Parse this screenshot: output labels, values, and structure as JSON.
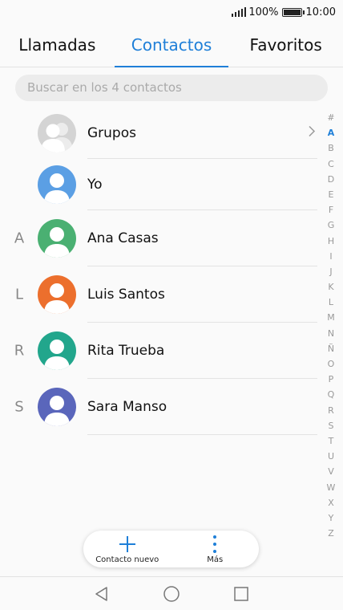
{
  "status_bar": {
    "battery_percent": "100%",
    "time": "10:00"
  },
  "tabs": [
    {
      "label": "Llamadas",
      "active": false
    },
    {
      "label": "Contactos",
      "active": true
    },
    {
      "label": "Favoritos",
      "active": false
    }
  ],
  "search": {
    "placeholder": "Buscar en los 4 contactos"
  },
  "contacts": [
    {
      "section": "",
      "name": "Grupos",
      "avatar_color": "#c8c8c8",
      "icon": "group-avatar-icon"
    },
    {
      "section": "",
      "name": "Yo",
      "avatar_color": "#5b9fe4",
      "icon": "person-avatar-icon"
    },
    {
      "section": "A",
      "name": "Ana Casas",
      "avatar_color": "#4ab072",
      "icon": "person-avatar-icon"
    },
    {
      "section": "L",
      "name": "Luis Santos",
      "avatar_color": "#ec6f2d",
      "icon": "person-avatar-icon"
    },
    {
      "section": "R",
      "name": "Rita Trueba",
      "avatar_color": "#22a68c",
      "icon": "person-avatar-icon"
    },
    {
      "section": "S",
      "name": "Sara Manso",
      "avatar_color": "#5a66bb",
      "icon": "person-avatar-icon"
    }
  ],
  "alphabet_index": [
    "#",
    "A",
    "B",
    "C",
    "D",
    "E",
    "F",
    "G",
    "H",
    "I",
    "J",
    "K",
    "L",
    "M",
    "N",
    "Ñ",
    "O",
    "P",
    "Q",
    "R",
    "S",
    "T",
    "U",
    "V",
    "W",
    "X",
    "Y",
    "Z"
  ],
  "alphabet_selected": "A",
  "bottom_bar": {
    "new_contact_label": "Contacto nuevo",
    "more_label": "Más"
  },
  "colors": {
    "accent": "#1f7fd8"
  }
}
